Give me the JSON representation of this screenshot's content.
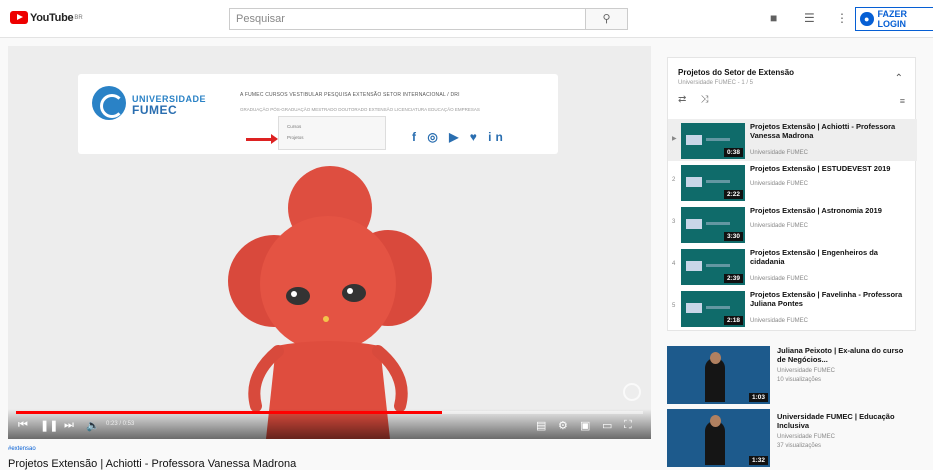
{
  "topbar": {
    "logo_text": "YouTube",
    "logo_sup": "BR",
    "search_placeholder": "Pesquisar",
    "login_label": "FAZER LOGIN"
  },
  "video": {
    "site_brand_line1": "UNIVERSIDADE",
    "site_brand_line2": "FUMEC",
    "site_menu": "A FUMEC   CURSOS   VESTIBULAR   PESQUISA   EXTENSÃO   SETOR INTERNACIONAL / DRI",
    "site_submenu": "GRADUAÇÃO   PÓS-GRADUAÇÃO   MESTRADO   DOUTORADO   EXTENSÃO   LICENCIATURA   EDUCAÇÃO   EMPRESAS",
    "dropdown_item1": "Cursos",
    "dropdown_item2": "Projetos",
    "social": "f ◎ ▶ ♥ in",
    "time": "0:23 / 0:53",
    "progress": 0.68
  },
  "below": {
    "tag": "#extensao",
    "title": "Projetos Extensão | Achiotti - Professora Vanessa Madrona"
  },
  "playlist": {
    "title": "Projetos do Setor de Extensão",
    "subtitle": "Universidade FUMEC - 1 / 5",
    "items": [
      {
        "idx": "▶",
        "title": "Projetos Extensão | Achiotti - Professora Vanessa Madrona",
        "channel": "Universidade FUMEC",
        "duration": "0:38"
      },
      {
        "idx": "2",
        "title": "Projetos Extensão | ESTUDEVEST 2019",
        "channel": "Universidade FUMEC",
        "duration": "2:22"
      },
      {
        "idx": "3",
        "title": "Projetos Extensão | Astronomia 2019",
        "channel": "Universidade FUMEC",
        "duration": "3:30"
      },
      {
        "idx": "4",
        "title": "Projetos Extensão | Engenheiros da cidadania",
        "channel": "Universidade FUMEC",
        "duration": "2:39"
      },
      {
        "idx": "5",
        "title": "Projetos Extensão | Favelinha - Professora Juliana Pontes",
        "channel": "Universidade FUMEC",
        "duration": "2:18"
      }
    ]
  },
  "recommended": [
    {
      "title": "Juliana Peixoto | Ex-aluna do curso de Negócios...",
      "channel": "Universidade FUMEC",
      "views": "10 visualizações",
      "duration": "1:03"
    },
    {
      "title": "Universidade FUMEC | Educação Inclusiva",
      "channel": "Universidade FUMEC",
      "views": "37 visualizações",
      "duration": "1:32"
    }
  ]
}
